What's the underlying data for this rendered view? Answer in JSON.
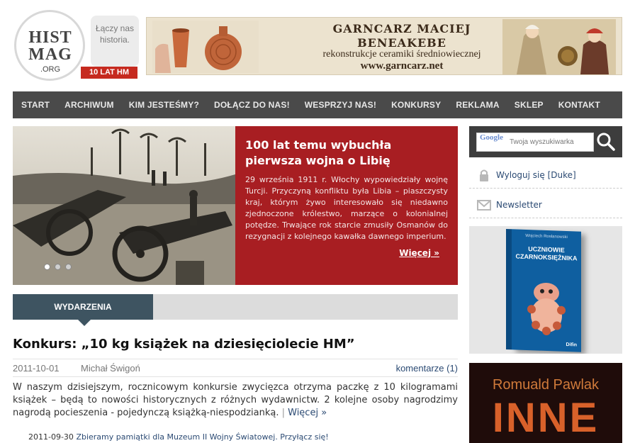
{
  "logo": {
    "line1": "HIST",
    "line2": "MAG",
    "org": ".ORG",
    "tagline": "Łączy nas historia.",
    "badge": "10 LAT HM"
  },
  "banner": {
    "line1": "GARNCARZ MACIEJ",
    "line2": "BENEAKEBE",
    "line3": "rekonstrukcje ceramiki średniowiecznej",
    "line4": "www.garncarz.net"
  },
  "nav": {
    "items": [
      "START",
      "ARCHIWUM",
      "KIM JESTEŚMY?",
      "DOŁĄCZ DO NAS!",
      "WESPRZYJ NAS!",
      "KONKURSY",
      "REKLAMA",
      "SKLEP",
      "KONTAKT"
    ]
  },
  "hero": {
    "title": "100 lat temu wybuchła pierwsza wojna o Libię",
    "text": "29 września 1911 r. Włochy wypowiedziały wojnę Turcji. Przyczyną konfliktu była Libia – piaszczysty kraj, którym żywo interesowało się niedawno zjednoczone królestwo, marzące o kolonialnej potędze. Trwające rok starcie zmusiły Osmanów do rezygnacji z kolejnego kawałka dawnego imperium.",
    "more": "Więcej »",
    "slides": 3,
    "active_slide": 1
  },
  "tabs": {
    "active": "WYDARZENIA"
  },
  "article": {
    "title": "Konkurs: „10 kg książek na dziesięciolecie HM”",
    "date": "2011-10-01",
    "author": "Michał Świgoń",
    "comments": "komentarze (1)",
    "body": "W naszym dzisiejszym, rocznicowym konkursie zwycięzca otrzyma paczkę z 10 kilogramami książek – będą to nowości historycznych z różnych wydawnictw. 2 kolejne osoby nagrodzimy nagrodą pocieszenia - pojedynczą książką-niespodzianką.",
    "separator": " | ",
    "more": "Więcej »"
  },
  "news": {
    "date": "2011-09-30",
    "link": "Zbieramy pamiątki dla Muzeum II Wojny Światowej. Przyłącz się!"
  },
  "sidebar": {
    "search_brand": "Google",
    "search_placeholder": "Twoja wyszukiwarka",
    "logout": "Wyloguj się [Duke]",
    "newsletter": "Newsletter",
    "book": {
      "author": "Wojciech Rosłanowski",
      "title": "UCZNIOWIE CZARNOKSIĘŻNIKA",
      "publisher": "Difin"
    },
    "ad": {
      "author": "Romuald Pawlak",
      "title": "INNE"
    }
  },
  "colors": {
    "nav_bg": "#4a4a4a",
    "hero_red": "#a81e22",
    "tab_active": "#3e5461",
    "link": "#2b4a73"
  }
}
